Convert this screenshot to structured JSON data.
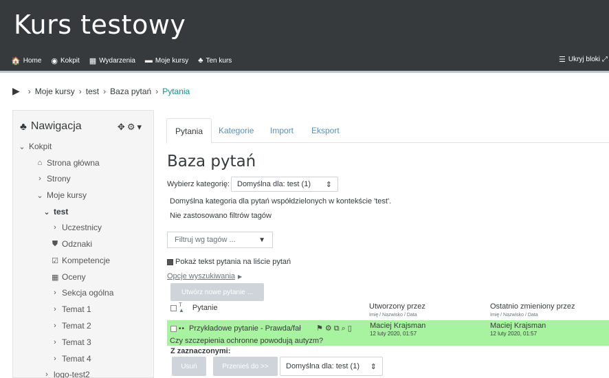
{
  "header": {
    "site_title": "Kurs testowy",
    "nav": [
      {
        "icon": "home-icon",
        "glyph": "🏠",
        "label": "Home"
      },
      {
        "icon": "dashboard-icon",
        "glyph": "◉",
        "label": "Kokpit"
      },
      {
        "icon": "calendar-icon",
        "glyph": "▦",
        "label": "Wydarzenia"
      },
      {
        "icon": "briefcase-icon",
        "glyph": "▬",
        "label": "Moje kursy"
      },
      {
        "icon": "sitemap-icon",
        "glyph": "♣",
        "label": "Ten kurs"
      }
    ],
    "hide_blocks_label": "Ukryj bloki"
  },
  "breadcrumb": {
    "items": [
      "Moje kursy",
      "test",
      "Baza pytań"
    ],
    "current": "Pytania"
  },
  "navigation": {
    "title": "Nawigacja",
    "tree": [
      {
        "label": "Kokpit",
        "glyph": "⌄"
      },
      {
        "label": "Strona główna",
        "glyph": "⌂"
      },
      {
        "label": "Strony",
        "glyph": "›"
      },
      {
        "label": "Moje kursy",
        "glyph": "⌄"
      },
      {
        "label": "test",
        "glyph": "⌄"
      },
      {
        "label": "Uczestnicy",
        "glyph": "›"
      },
      {
        "label": "Odznaki",
        "glyph": "⛊"
      },
      {
        "label": "Kompetencje",
        "glyph": "☑"
      },
      {
        "label": "Oceny",
        "glyph": "▦"
      },
      {
        "label": "Sekcja ogólna",
        "glyph": "›"
      },
      {
        "label": "Temat 1",
        "glyph": "›"
      },
      {
        "label": "Temat 2",
        "glyph": "›"
      },
      {
        "label": "Temat 3",
        "glyph": "›"
      },
      {
        "label": "Temat 4",
        "glyph": "›"
      },
      {
        "label": "logo-test2",
        "glyph": "›"
      }
    ]
  },
  "tabs": [
    "Pytania",
    "Kategorie",
    "Import",
    "Eksport"
  ],
  "main": {
    "heading": "Baza pytań",
    "category_label": "Wybierz kategorię:",
    "category_value": "Domyślna dla: test (1)",
    "category_desc": "Domyślna kategoria dla pytań współdzielonych w kontekście 'test'.",
    "no_tag_filters": "Nie zastosowano filtrów tagów",
    "filter_placeholder": "Filtruj wg tagów ...",
    "show_text_label": "Pokaż tekst pytania na liście pytań",
    "search_options": "Opcje wyszukiwania",
    "new_question_button": "Utwórz nowe pytanie ..."
  },
  "table": {
    "col_question": "Pytanie",
    "col_created": "Utworzony przez",
    "col_created_sub": "Imię / Nazwisko / Data",
    "col_modified": "Ostatnio zmieniony przez",
    "col_modified_sub": "Imię / Nazwisko / Data",
    "row": {
      "name": "Przykładowe pytanie - Prawda/fał",
      "text": "Czy szczepienia ochronne powodują autyzm?",
      "created_by": "Maciej Krajsman",
      "created_date": "12 luty 2020, 01:57",
      "modified_by": "Maciej Krajsman",
      "modified_date": "12 luty 2020, 01:57"
    }
  },
  "bulk": {
    "label": "Z zaznaczonymi:",
    "delete_button": "Usuń",
    "move_button": "Przenieś do >>",
    "target_category": "Domyślna dla: test (1)"
  },
  "colors": {
    "header_bg": "#373a3c",
    "row_highlight": "#a8f3a0",
    "breadcrumb_active": "#0f8f8f",
    "disabled_button": "#ced4da"
  }
}
